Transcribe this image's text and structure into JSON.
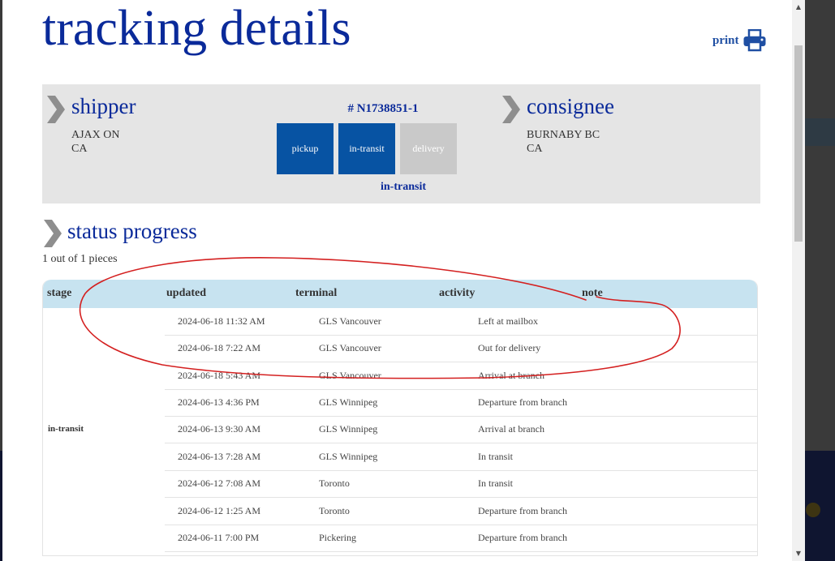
{
  "page": {
    "title": "tracking details",
    "print_label": "print"
  },
  "shipper": {
    "label": "shipper",
    "line1": "AJAX ON",
    "line2": "CA"
  },
  "consignee": {
    "label": "consignee",
    "line1": "BURNABY BC",
    "line2": "CA"
  },
  "shipment": {
    "tracking_number": "# N1738851-1",
    "steps": [
      {
        "label": "pickup",
        "state": "active"
      },
      {
        "label": "in-transit",
        "state": "active"
      },
      {
        "label": "delivery",
        "state": "inactive"
      }
    ],
    "current_status": "in-transit"
  },
  "progress": {
    "title": "status progress",
    "pieces": "1 out of 1 pieces",
    "columns": [
      "stage",
      "updated",
      "terminal",
      "activity",
      "note"
    ],
    "stage": "in-transit",
    "rows": [
      {
        "updated": "2024-06-18 11:32 AM",
        "terminal": "GLS Vancouver",
        "activity": "Left at mailbox",
        "note": ""
      },
      {
        "updated": "2024-06-18 7:22 AM",
        "terminal": "GLS Vancouver",
        "activity": "Out for delivery",
        "note": ""
      },
      {
        "updated": "2024-06-18 5:43 AM",
        "terminal": "GLS Vancouver",
        "activity": "Arrival at branch",
        "note": ""
      },
      {
        "updated": "2024-06-13 4:36 PM",
        "terminal": "GLS Winnipeg",
        "activity": "Departure from branch",
        "note": ""
      },
      {
        "updated": "2024-06-13 9:30 AM",
        "terminal": "GLS Winnipeg",
        "activity": "Arrival at branch",
        "note": ""
      },
      {
        "updated": "2024-06-13 7:28 AM",
        "terminal": "GLS Winnipeg",
        "activity": "In transit",
        "note": ""
      },
      {
        "updated": "2024-06-12 7:08 AM",
        "terminal": "Toronto",
        "activity": "In transit",
        "note": ""
      },
      {
        "updated": "2024-06-12 1:25 AM",
        "terminal": "Toronto",
        "activity": "Departure from branch",
        "note": ""
      },
      {
        "updated": "2024-06-11 7:00 PM",
        "terminal": "Pickering",
        "activity": "Departure from branch",
        "note": ""
      }
    ]
  },
  "colors": {
    "heading": "#0a2a9a",
    "step_active": "#0753a3",
    "step_inactive": "#c9c9c9",
    "table_header": "#c7e3f0",
    "annotation": "#d42020"
  },
  "icons": {
    "print": "printer-icon",
    "section": "chevron-right-icon"
  }
}
